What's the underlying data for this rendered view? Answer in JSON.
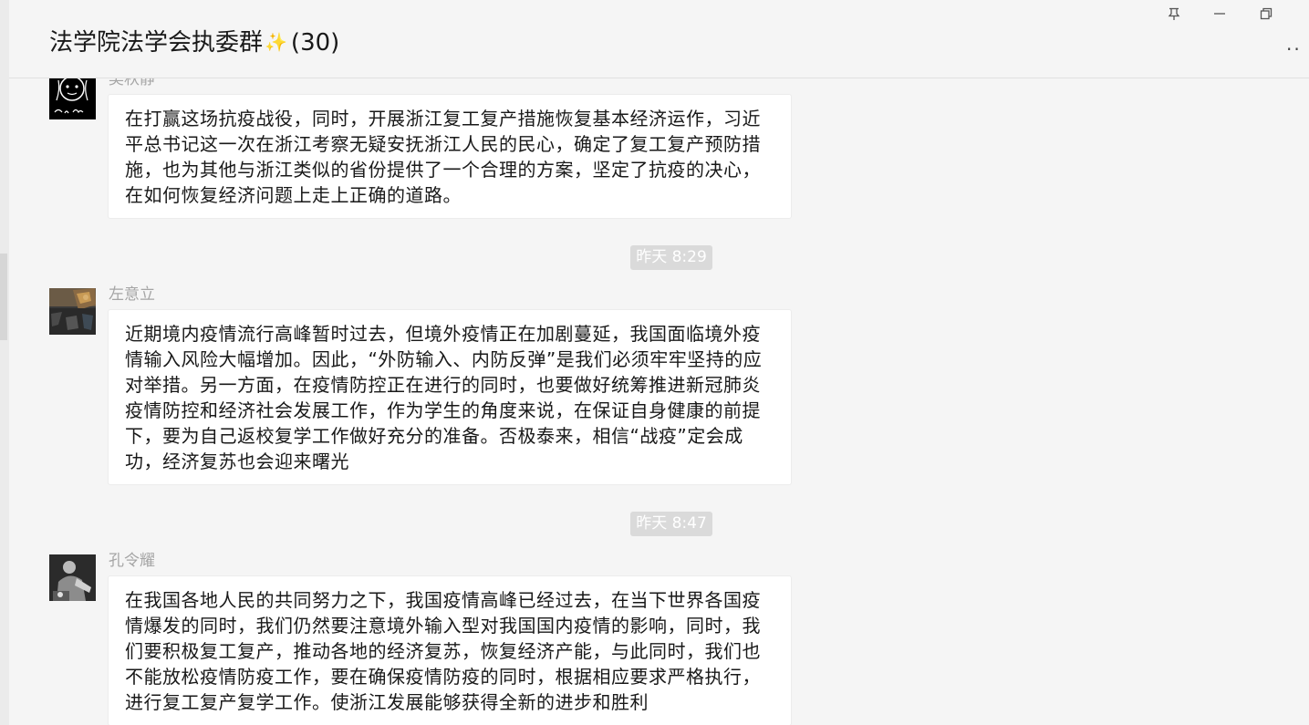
{
  "window": {
    "title": "法学院法学会执委群",
    "member_count": "(30)",
    "title_emoji": "✨",
    "controls": {
      "pin": "pin-icon",
      "minimize": "minimize-icon",
      "restore": "restore-icon"
    },
    "more_menu": "··"
  },
  "messages": [
    {
      "sender": "吴秋静",
      "avatar": "avatar-sketch",
      "text": "在打赢这场抗疫战役，同时，开展浙江复工复产措施恢复基本经济运作，习近平总书记这一次在浙江考察无疑安抚浙江人民的民心，确定了复工复产预防措施，也为其他与浙江类似的省份提供了一个合理的方案，坚定了抗疫的决心，在如何恢复经济问题上走上正确的道路。"
    },
    {
      "time": "昨天 8:29",
      "sender": "左意立",
      "avatar": "avatar-photo",
      "text": "近期境内疫情流行高峰暂时过去，但境外疫情正在加剧蔓延，我国面临境外疫情输入风险大幅增加。因此，“外防输入、内防反弹”是我们必须牢牢坚持的应对举措。另一方面，在疫情防控正在进行的同时，也要做好统筹推进新冠肺炎疫情防控和经济社会发展工作，作为学生的角度来说，在保证自身健康的前提下，要为自己返校复学工作做好充分的准备。否极泰来，相信“战疫”定会成功，经济复苏也会迎来曙光"
    },
    {
      "time": "昨天 8:47",
      "sender": "孔令耀",
      "avatar": "avatar-photo",
      "text": "在我国各地人民的共同努力之下，我国疫情高峰已经过去，在当下世界各国疫情爆发的同时，我们仍然要注意境外输入型对我国国内疫情的影响，同时，我们要积极复工复产，推动各地的经济复苏，恢复经济产能，与此同时，我们也不能放松疫情防疫工作，要在确保疫情防疫的同时，根据相应要求严格执行，进行复工复产复学工作。使浙江发展能够获得全新的进步和胜利"
    }
  ]
}
